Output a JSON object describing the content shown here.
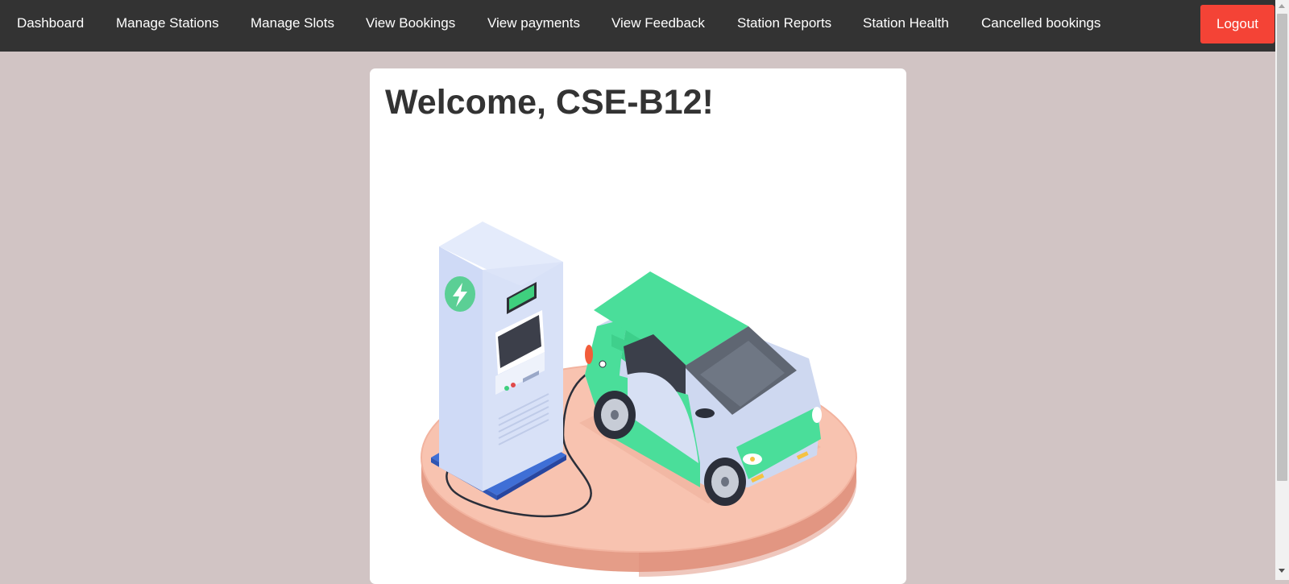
{
  "nav": {
    "items": [
      {
        "label": "Dashboard"
      },
      {
        "label": "Manage Stations"
      },
      {
        "label": "Manage Slots"
      },
      {
        "label": "View Bookings"
      },
      {
        "label": "View payments"
      },
      {
        "label": "View Feedback"
      },
      {
        "label": "Station Reports"
      },
      {
        "label": "Station Health"
      },
      {
        "label": "Cancelled bookings"
      }
    ],
    "logout_label": "Logout"
  },
  "main": {
    "welcome": "Welcome, CSE-B12!",
    "illustration": "ev-charging-station-illustration"
  },
  "colors": {
    "navbar": "#333333",
    "logout": "#f44336",
    "background": "#d1c4c4",
    "car": "#4ade9a"
  }
}
